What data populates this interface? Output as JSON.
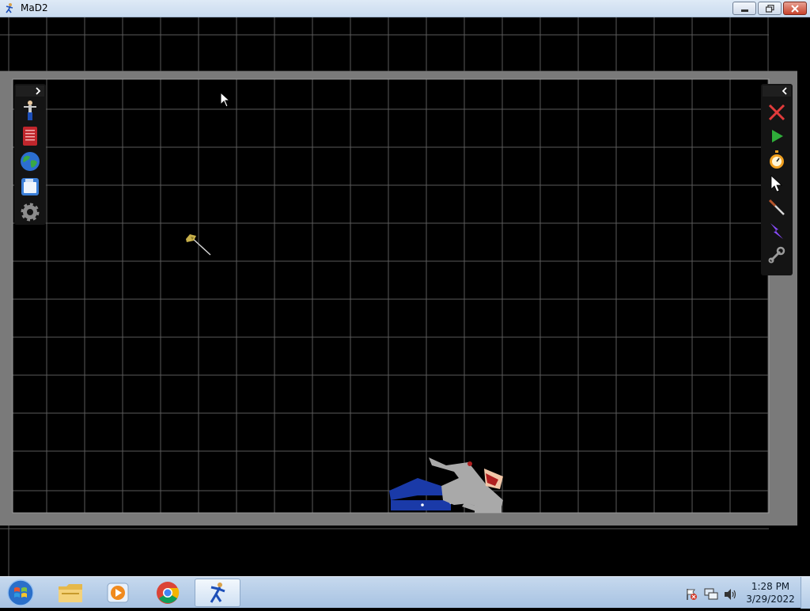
{
  "window": {
    "title": "MaD2",
    "controls": [
      "minimize",
      "restore",
      "close"
    ]
  },
  "left_toolbar": {
    "toggle_icon": "chevron-right-icon",
    "tools": [
      {
        "name": "ragdoll-spawn",
        "icon": "ragdoll-icon"
      },
      {
        "name": "item-catalog",
        "icon": "red-book-icon"
      },
      {
        "name": "world",
        "icon": "globe-icon"
      },
      {
        "name": "save",
        "icon": "floppy-disk-icon"
      },
      {
        "name": "settings",
        "icon": "gear-icon"
      }
    ]
  },
  "right_toolbar": {
    "toggle_icon": "chevron-left-icon",
    "tools": [
      {
        "name": "delete",
        "icon": "red-x-icon",
        "color": "#e23b3b"
      },
      {
        "name": "play",
        "icon": "play-icon",
        "color": "#2fae3a"
      },
      {
        "name": "time",
        "icon": "stopwatch-icon",
        "color": "#f0a020"
      },
      {
        "name": "select",
        "icon": "pointer-icon",
        "color": "#ffffff"
      },
      {
        "name": "knife",
        "icon": "knife-icon",
        "color": "#c0392b"
      },
      {
        "name": "power",
        "icon": "lightning-icon",
        "color": "#8a4bff"
      },
      {
        "name": "wrench",
        "icon": "wrench-icon",
        "color": "#9a9a9a"
      }
    ]
  },
  "scene": {
    "objects": [
      "axe-item",
      "ragdoll-body"
    ]
  },
  "taskbar": {
    "start": "windows-start-icon",
    "apps": [
      {
        "name": "file-explorer",
        "icon": "folder-icon"
      },
      {
        "name": "media-player",
        "icon": "media-player-icon"
      },
      {
        "name": "chrome",
        "icon": "chrome-icon"
      },
      {
        "name": "mad2",
        "icon": "mad2-app-icon",
        "active": true
      }
    ],
    "tray": [
      "action-center-flag-icon",
      "network-icon",
      "volume-icon"
    ],
    "clock": {
      "time": "1:28 PM",
      "date": "3/29/2022"
    }
  }
}
